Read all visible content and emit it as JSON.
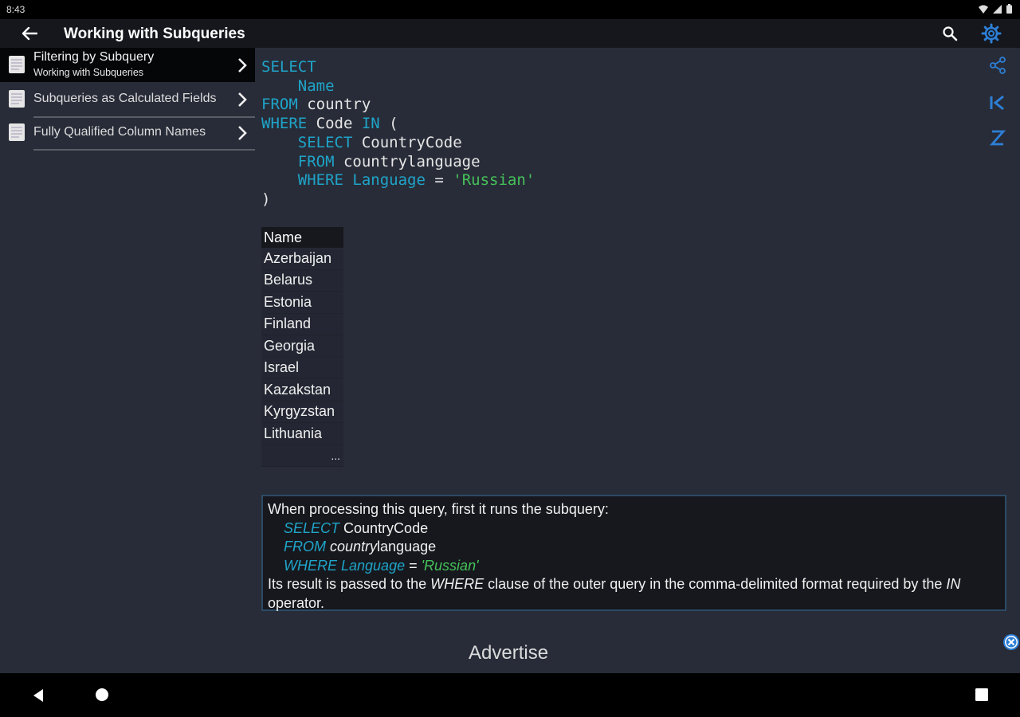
{
  "status_bar": {
    "time": "8:43"
  },
  "app_bar": {
    "title": "Working with Subqueries"
  },
  "sidebar": {
    "items": [
      {
        "title": "Filtering by Subquery",
        "subtitle": "Working with Subqueries",
        "active": true
      },
      {
        "title": "Subqueries as Calculated Fields"
      },
      {
        "title": "Fully Qualified Column Names"
      }
    ]
  },
  "code": {
    "t1": "SELECT",
    "t2": "Name",
    "t3": "FROM",
    "t4": " country",
    "t5": "WHERE",
    "t6": " Code ",
    "t7": "IN",
    "t8": " (",
    "t9": "SELECT",
    "t10": " CountryCode",
    "t11": "FROM",
    "t12": " countrylanguage",
    "t13": "WHERE Language",
    "t14": " = ",
    "t15": "'Russian'",
    "t16": ")"
  },
  "results": {
    "header": "Name",
    "rows": [
      "Azerbaijan",
      "Belarus",
      "Estonia",
      "Finland",
      "Georgia",
      "Israel",
      "Kazakstan",
      "Kyrgyzstan",
      "Lithuania"
    ],
    "more": "..."
  },
  "explanation": {
    "p1": "When processing this query, first it runs the subquery:",
    "k1": "SELECT",
    "v1": " CountryCode",
    "k2": "FROM",
    "v2a": " country",
    "v2b": "language",
    "k3": "WHERE Language",
    "v3": " = ",
    "s3": "'Russian'",
    "p2a": "Its result is passed to the ",
    "p2b": "WHERE",
    "p2c": " clause of the outer query in the comma-delimited format required by the ",
    "p2d": "IN",
    "p2e": " operator."
  },
  "ad": {
    "label": "Advertise"
  },
  "colors": {
    "keyword": "#1fa4c9",
    "string": "#45c25a",
    "accent": "#2d7fd6"
  }
}
